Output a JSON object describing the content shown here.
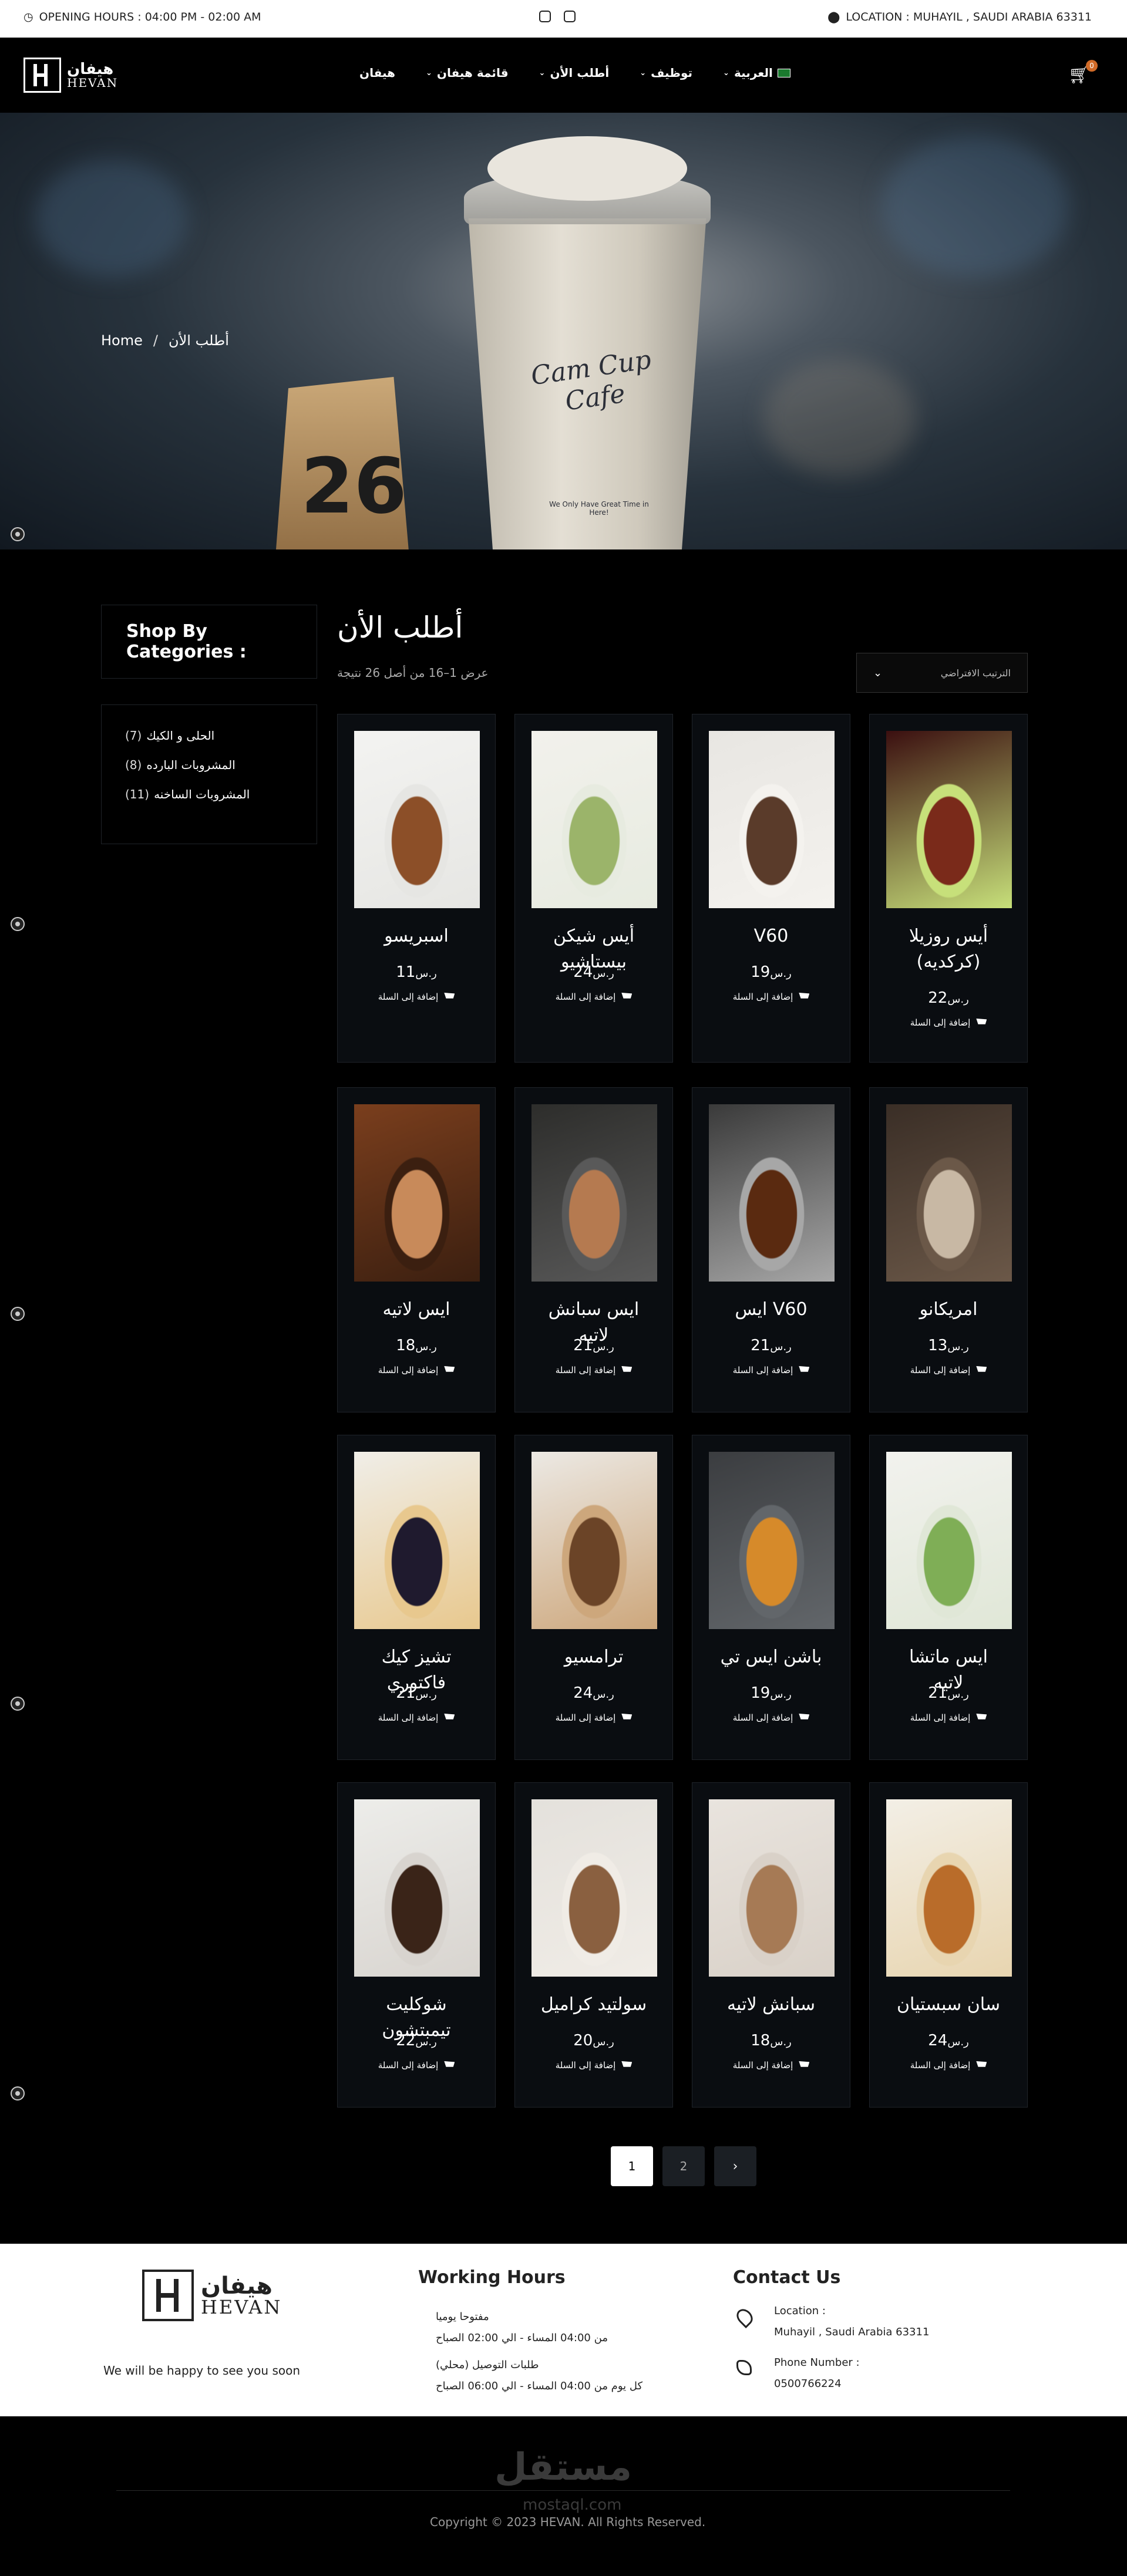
{
  "topbar": {
    "hours": "OPENING HOURS :  04:00 PM - 02:00 AM",
    "location": "LOCATION :  MUHAYIL , SAUDI ARABIA 63311"
  },
  "header": {
    "logo_ar": "هيفان",
    "logo_en": "HEVAN",
    "cart_count": "0",
    "nav": [
      {
        "label": "هيفان",
        "has_dropdown": false
      },
      {
        "label": "قائمة هيفان",
        "has_dropdown": true
      },
      {
        "label": "أطلب الأن",
        "has_dropdown": true
      },
      {
        "label": "توظيف",
        "has_dropdown": true
      },
      {
        "label": "العربية",
        "has_dropdown": true
      }
    ]
  },
  "hero": {
    "crumb_home": "Home",
    "crumb_sep": "/",
    "crumb_current": "أطلب الأن",
    "cup_brand": "Cam Cup Cafe",
    "cup_tagline": "We Only Have Great Time in Here!",
    "sign_number": "26"
  },
  "sidebar": {
    "title": "Shop By Categories :",
    "categories": [
      {
        "count": "(7)",
        "label": "الحلى و الكيك"
      },
      {
        "count": "(8)",
        "label": "المشروبات البارده"
      },
      {
        "count": "(11)",
        "label": "المشروبات الساخنه"
      }
    ]
  },
  "main": {
    "title": "أطلب الأن",
    "results": "عرض 1–16 من أصل 26 نتيجة",
    "sort": "الترتيب الافتراضي"
  },
  "add_to_cart_label": "إضافة إلى السلة",
  "currency": "ر.س",
  "products": [
    {
      "name": "أيس روزيلا (كركديه)",
      "price": "22",
      "colors": [
        "#3b0f10",
        "#7a2a1a",
        "#c7e07a"
      ]
    },
    {
      "name": "V60",
      "price": "19",
      "colors": [
        "#e8e6e2",
        "#5a3b2a",
        "#f4f2ee"
      ]
    },
    {
      "name": "أيس شيكن بيستاشيو",
      "price": "24",
      "colors": [
        "#f2f1ec",
        "#9bb46a",
        "#e7ebe0"
      ]
    },
    {
      "name": "اسبريسو",
      "price": "11",
      "colors": [
        "#f3f3f1",
        "#8c4f28",
        "#e6e6e3"
      ]
    },
    {
      "name": "امريكانو",
      "price": "13",
      "colors": [
        "#3a2e26",
        "#c8b8a4",
        "#6b5848"
      ]
    },
    {
      "name": "ايس V60",
      "price": "21",
      "colors": [
        "#3a3a3a",
        "#5a2a10",
        "#a7a7a7"
      ]
    },
    {
      "name": "ايس سبانش لاتيه",
      "price": "21",
      "colors": [
        "#2d2d2b",
        "#b57a50",
        "#595959"
      ]
    },
    {
      "name": "ايس لاتيه",
      "price": "18",
      "colors": [
        "#7a3e1d",
        "#c88a5a",
        "#3b1f10"
      ]
    },
    {
      "name": "ايس ماتشا لاتيه",
      "price": "21",
      "colors": [
        "#f2f2ee",
        "#7fae56",
        "#e0e7d7"
      ]
    },
    {
      "name": "باشن ايس تي",
      "price": "19",
      "colors": [
        "#3b3d40",
        "#d68a2a",
        "#62666a"
      ]
    },
    {
      "name": "ترامسيو",
      "price": "24",
      "colors": [
        "#ece9e4",
        "#6b4427",
        "#cda77c"
      ]
    },
    {
      "name": "تشيز كيك فاكتوري",
      "price": "21",
      "colors": [
        "#f0eee8",
        "#1f1a2e",
        "#e8c88e"
      ]
    },
    {
      "name": "سان سبستيان",
      "price": "24",
      "colors": [
        "#f3efe6",
        "#b96c2a",
        "#e8d5b0"
      ]
    },
    {
      "name": "سبانش لاتيه",
      "price": "18",
      "colors": [
        "#e9e4de",
        "#a67a55",
        "#d9d1c8"
      ]
    },
    {
      "name": "سولتيد كراميل",
      "price": "20",
      "colors": [
        "#e4e1dc",
        "#8a6040",
        "#f0ece6"
      ]
    },
    {
      "name": "شوكليت تيمبتشون",
      "price": "22",
      "colors": [
        "#ededea",
        "#3a2418",
        "#d8d4cf"
      ]
    }
  ],
  "pagination": {
    "current": "1",
    "next_page": "2",
    "next_icon": "chevron-right-icon"
  },
  "footer": {
    "logo_ar": "هيفان",
    "logo_en": "HEVAN",
    "tagline": "We will be happy to see you soon",
    "hours_title": "Working Hours",
    "hours_lines": [
      "مفتوحا يوميا",
      "من 04:00 المساء - الي 02:00 الصباح",
      "طلبات التوصيل (محلي)",
      "كل يوم من 04:00 المساء - الي 06:00 الصباح"
    ],
    "contact_title": "Contact Us",
    "location_label": "Location :",
    "location_value": "Muhayil , Saudi Arabia 63311",
    "phone_label": "Phone Number :",
    "phone_value": "0500766224",
    "copyright": "Copyright © 2023 HEVAN. All Rights Reserved.",
    "watermark_ar": "مستقل",
    "watermark_en": "mostaql.com"
  }
}
